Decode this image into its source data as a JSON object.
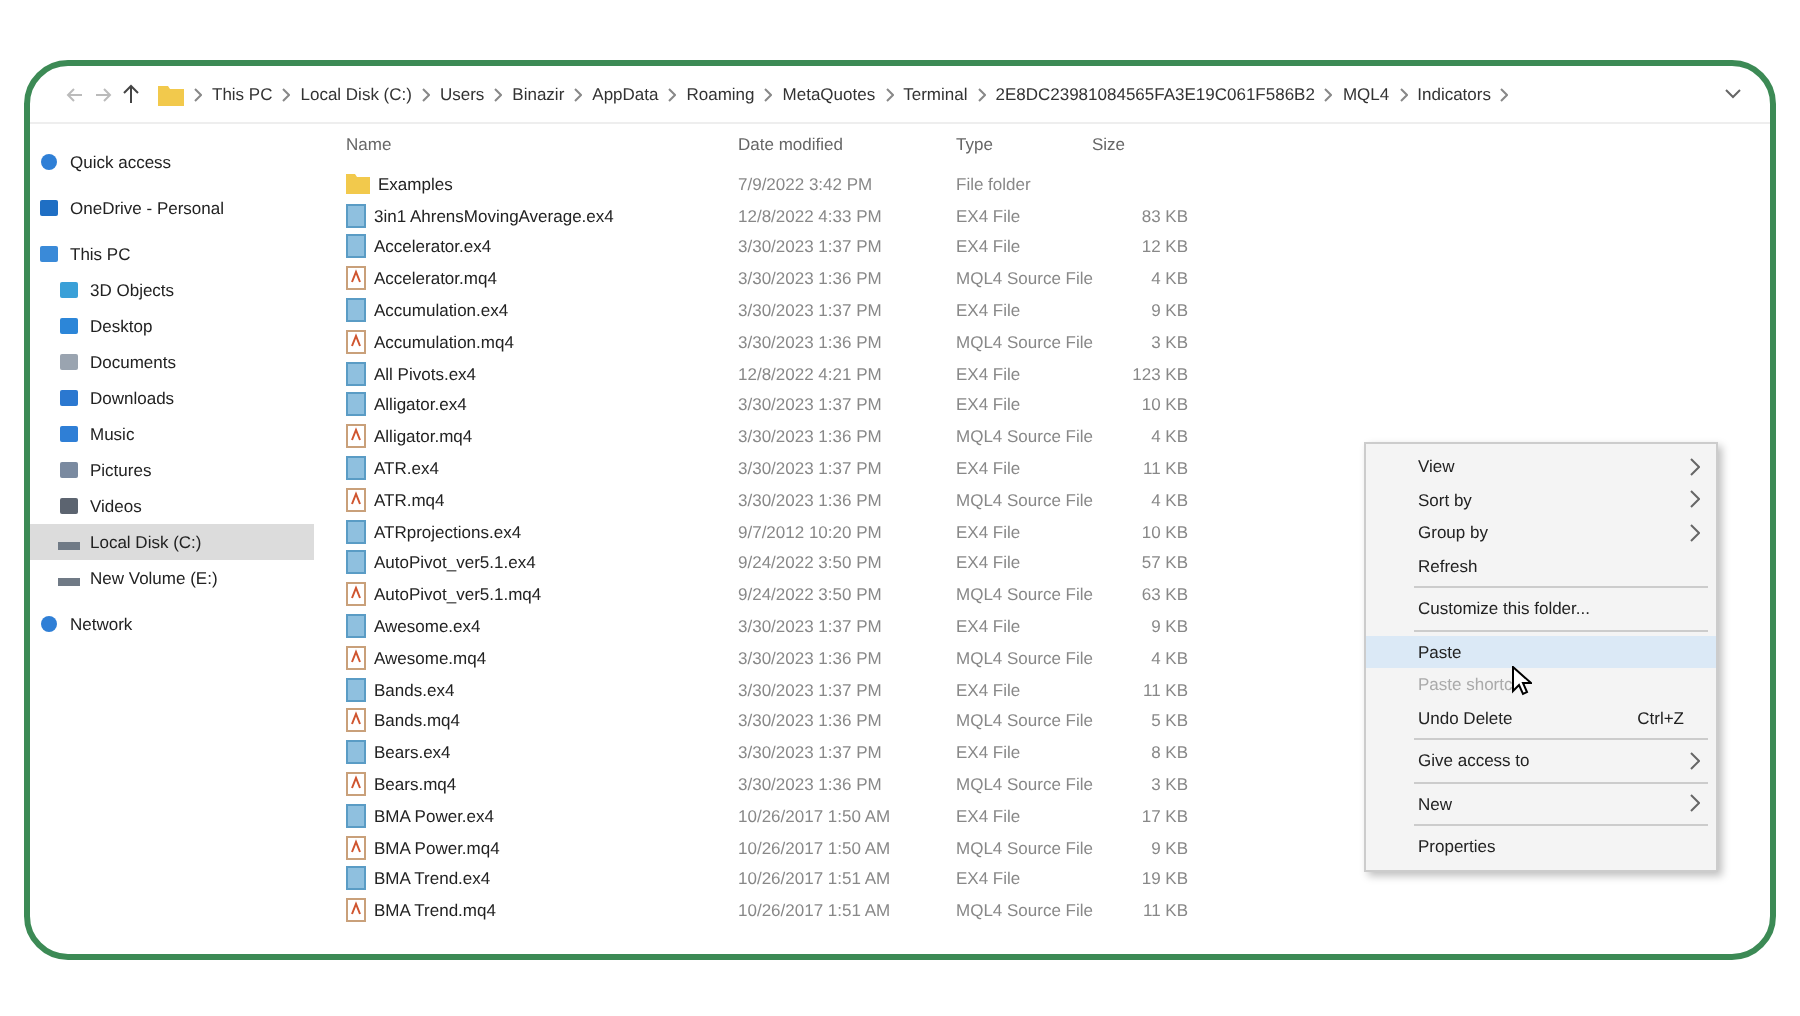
{
  "breadcrumb": [
    "This PC",
    "Local Disk (C:)",
    "Users",
    "Binazir",
    "AppData",
    "Roaming",
    "MetaQuotes",
    "Terminal",
    "2E8DC23981084565FA3E19C061F586B2",
    "MQL4",
    "Indicators"
  ],
  "sidebar": {
    "items": [
      {
        "label": "Quick access",
        "selected": false
      },
      {
        "label": "OneDrive - Personal",
        "selected": false
      },
      {
        "label": "This PC",
        "selected": false,
        "children": [
          {
            "label": "3D Objects",
            "selected": false
          },
          {
            "label": "Desktop",
            "selected": false
          },
          {
            "label": "Documents",
            "selected": false
          },
          {
            "label": "Downloads",
            "selected": false
          },
          {
            "label": "Music",
            "selected": false
          },
          {
            "label": "Pictures",
            "selected": false
          },
          {
            "label": "Videos",
            "selected": false
          },
          {
            "label": "Local Disk (C:)",
            "selected": true
          },
          {
            "label": "New Volume (E:)",
            "selected": false
          }
        ]
      },
      {
        "label": "Network",
        "selected": false
      }
    ]
  },
  "table": {
    "columns": [
      "Name",
      "Date modified",
      "Type",
      "Size"
    ],
    "rows": [
      {
        "kind": "folder",
        "name": "Examples",
        "date": "7/9/2022 3:42 PM",
        "type": "File folder",
        "size": ""
      },
      {
        "kind": "ex4",
        "name": "3in1 AhrensMovingAverage.ex4",
        "date": "12/8/2022 4:33 PM",
        "type": "EX4 File",
        "size": "83 KB"
      },
      {
        "kind": "ex4",
        "name": "Accelerator.ex4",
        "date": "3/30/2023 1:37 PM",
        "type": "EX4 File",
        "size": "12 KB"
      },
      {
        "kind": "mq4",
        "name": "Accelerator.mq4",
        "date": "3/30/2023 1:36 PM",
        "type": "MQL4 Source File",
        "size": "4 KB"
      },
      {
        "kind": "ex4",
        "name": "Accumulation.ex4",
        "date": "3/30/2023 1:37 PM",
        "type": "EX4 File",
        "size": "9 KB"
      },
      {
        "kind": "mq4",
        "name": "Accumulation.mq4",
        "date": "3/30/2023 1:36 PM",
        "type": "MQL4 Source File",
        "size": "3 KB"
      },
      {
        "kind": "ex4",
        "name": "All Pivots.ex4",
        "date": "12/8/2022 4:21 PM",
        "type": "EX4 File",
        "size": "123 KB"
      },
      {
        "kind": "ex4",
        "name": "Alligator.ex4",
        "date": "3/30/2023 1:37 PM",
        "type": "EX4 File",
        "size": "10 KB"
      },
      {
        "kind": "mq4",
        "name": "Alligator.mq4",
        "date": "3/30/2023 1:36 PM",
        "type": "MQL4 Source File",
        "size": "4 KB"
      },
      {
        "kind": "ex4",
        "name": "ATR.ex4",
        "date": "3/30/2023 1:37 PM",
        "type": "EX4 File",
        "size": "11 KB"
      },
      {
        "kind": "mq4",
        "name": "ATR.mq4",
        "date": "3/30/2023 1:36 PM",
        "type": "MQL4 Source File",
        "size": "4 KB"
      },
      {
        "kind": "ex4",
        "name": "ATRprojections.ex4",
        "date": "9/7/2012 10:20 PM",
        "type": "EX4 File",
        "size": "10 KB"
      },
      {
        "kind": "ex4",
        "name": "AutoPivot_ver5.1.ex4",
        "date": "9/24/2022 3:50 PM",
        "type": "EX4 File",
        "size": "57 KB"
      },
      {
        "kind": "mq4",
        "name": "AutoPivot_ver5.1.mq4",
        "date": "9/24/2022 3:50 PM",
        "type": "MQL4 Source File",
        "size": "63 KB"
      },
      {
        "kind": "ex4",
        "name": "Awesome.ex4",
        "date": "3/30/2023 1:37 PM",
        "type": "EX4 File",
        "size": "9 KB"
      },
      {
        "kind": "mq4",
        "name": "Awesome.mq4",
        "date": "3/30/2023 1:36 PM",
        "type": "MQL4 Source File",
        "size": "4 KB"
      },
      {
        "kind": "ex4",
        "name": "Bands.ex4",
        "date": "3/30/2023 1:37 PM",
        "type": "EX4 File",
        "size": "11 KB"
      },
      {
        "kind": "mq4",
        "name": "Bands.mq4",
        "date": "3/30/2023 1:36 PM",
        "type": "MQL4 Source File",
        "size": "5 KB"
      },
      {
        "kind": "ex4",
        "name": "Bears.ex4",
        "date": "3/30/2023 1:37 PM",
        "type": "EX4 File",
        "size": "8 KB"
      },
      {
        "kind": "mq4",
        "name": "Bears.mq4",
        "date": "3/30/2023 1:36 PM",
        "type": "MQL4 Source File",
        "size": "3 KB"
      },
      {
        "kind": "ex4",
        "name": "BMA Power.ex4",
        "date": "10/26/2017 1:50 AM",
        "type": "EX4 File",
        "size": "17 KB"
      },
      {
        "kind": "mq4",
        "name": "BMA Power.mq4",
        "date": "10/26/2017 1:50 AM",
        "type": "MQL4 Source File",
        "size": "9 KB"
      },
      {
        "kind": "ex4",
        "name": "BMA Trend.ex4",
        "date": "10/26/2017 1:51 AM",
        "type": "EX4 File",
        "size": "19 KB"
      },
      {
        "kind": "mq4",
        "name": "BMA Trend.mq4",
        "date": "10/26/2017 1:51 AM",
        "type": "MQL4 Source File",
        "size": "11 KB"
      }
    ]
  },
  "context_menu": {
    "groups": [
      [
        {
          "label": "View",
          "submenu": true,
          "disabled": false,
          "selected": false
        },
        {
          "label": "Sort by",
          "submenu": true,
          "disabled": false,
          "selected": false
        },
        {
          "label": "Group by",
          "submenu": true,
          "disabled": false,
          "selected": false
        },
        {
          "label": "Refresh",
          "submenu": false,
          "disabled": false,
          "selected": false
        }
      ],
      [
        {
          "label": "Customize this folder...",
          "submenu": false,
          "disabled": false,
          "selected": false
        }
      ],
      [
        {
          "label": "Paste",
          "submenu": false,
          "disabled": false,
          "selected": true
        },
        {
          "label": "Paste shortc",
          "submenu": false,
          "disabled": true,
          "selected": false
        },
        {
          "label": "Undo Delete",
          "shortcut": "Ctrl+Z",
          "submenu": false,
          "disabled": false,
          "selected": false
        }
      ],
      [
        {
          "label": "Give access to",
          "submenu": true,
          "disabled": false,
          "selected": false
        }
      ],
      [
        {
          "label": "New",
          "submenu": true,
          "disabled": false,
          "selected": false
        }
      ],
      [
        {
          "label": "Properties",
          "submenu": false,
          "disabled": false,
          "selected": false
        }
      ]
    ]
  }
}
